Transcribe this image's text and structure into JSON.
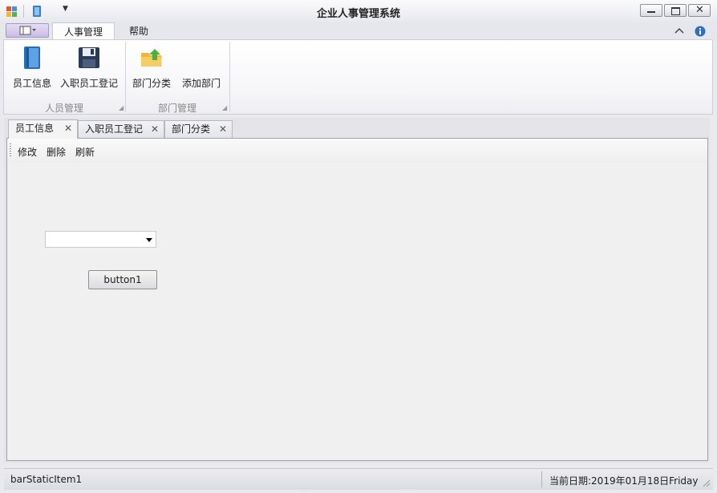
{
  "window": {
    "title": "企业人事管理系统"
  },
  "ribbon": {
    "tabs": [
      {
        "label": "人事管理",
        "active": true
      },
      {
        "label": "帮助",
        "active": false
      }
    ],
    "groups": [
      {
        "caption": "人员管理",
        "buttons": [
          {
            "label": "员工信息",
            "icon": "book-icon"
          },
          {
            "label": "入职员工登记",
            "icon": "floppy-disk-icon"
          }
        ]
      },
      {
        "caption": "部门管理",
        "buttons": [
          {
            "label": "部门分类",
            "icon": "folder-up-icon"
          },
          {
            "label": "添加部门",
            "icon": ""
          }
        ]
      }
    ]
  },
  "document_tabs": [
    {
      "label": "员工信息",
      "active": true
    },
    {
      "label": "入职员工登记",
      "active": false
    },
    {
      "label": "部门分类",
      "active": false
    }
  ],
  "content_toolbar": {
    "items": [
      "修改",
      "删除",
      "刷新"
    ]
  },
  "form": {
    "combo_value": "",
    "button_label": "button1"
  },
  "statusbar": {
    "left": "barStaticItem1",
    "right": "当前日期:2019年01月18日Friday"
  },
  "colors": {
    "accent_tab_border": "#c8c9d2",
    "app_button": "#c9bce4",
    "background": "#f0f0f0"
  }
}
